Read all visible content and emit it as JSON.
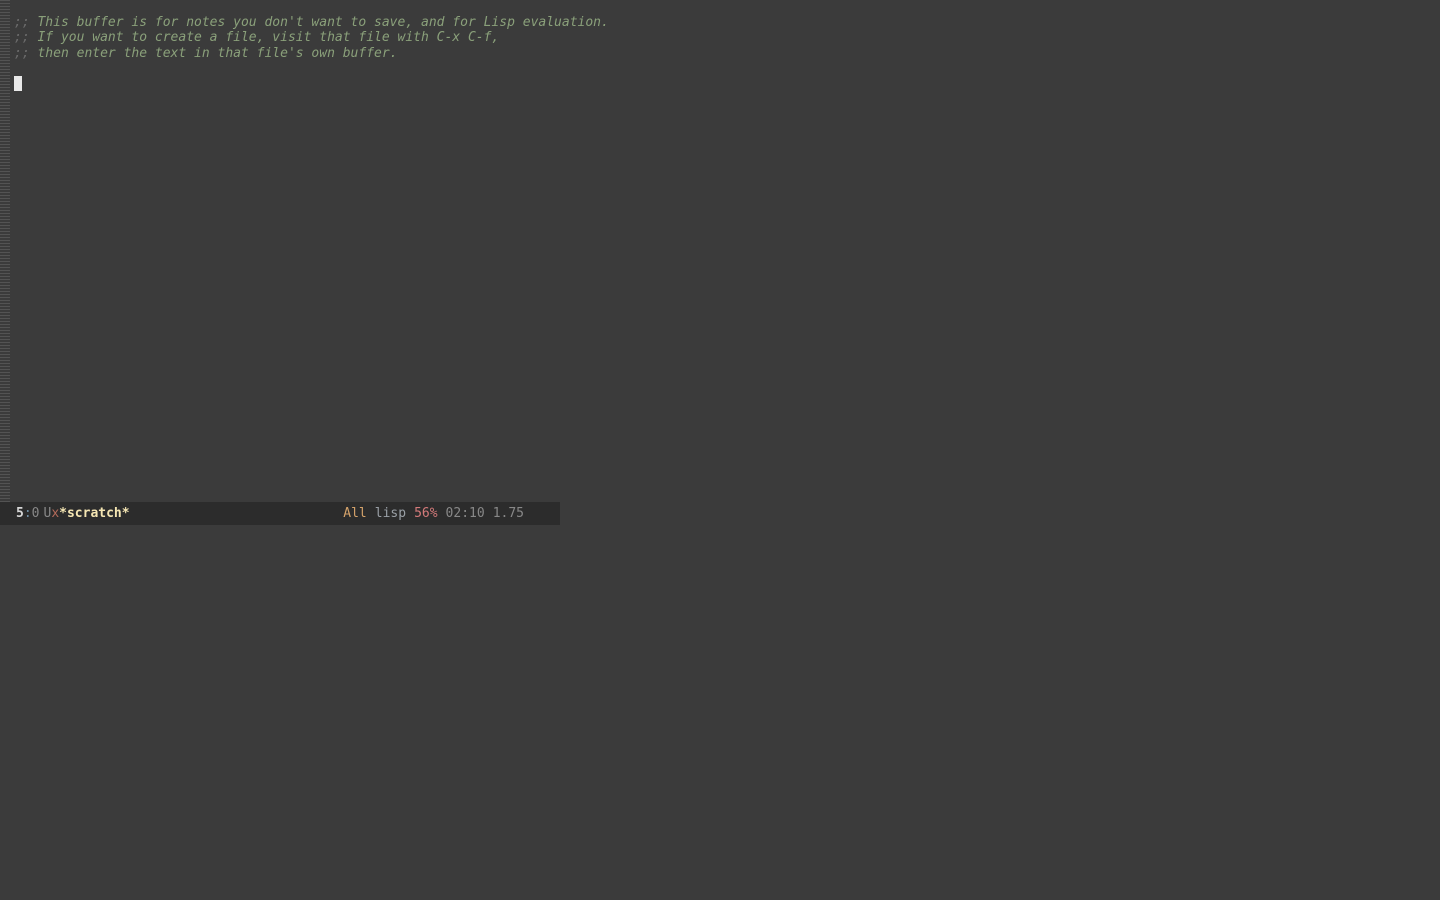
{
  "scratch_message": {
    "line1_delim": ";; ",
    "line1": "This buffer is for notes you don't want to save, and for Lisp evaluation.",
    "line2_delim": ";; ",
    "line2": "If you want to create a file, visit that file with C-x C-f,",
    "line3_delim": ";; ",
    "line3": "then enter the text in that file's own buffer."
  },
  "mode_line": {
    "line_number": "5",
    "colon": ":",
    "column_number": " 0",
    "u_flag": "U",
    "x_flag": "x",
    "buffer_name": "*scratch*",
    "position": "All",
    "major_mode": "lisp",
    "percent": "56%",
    "time": "02:10",
    "load": "1.75"
  }
}
